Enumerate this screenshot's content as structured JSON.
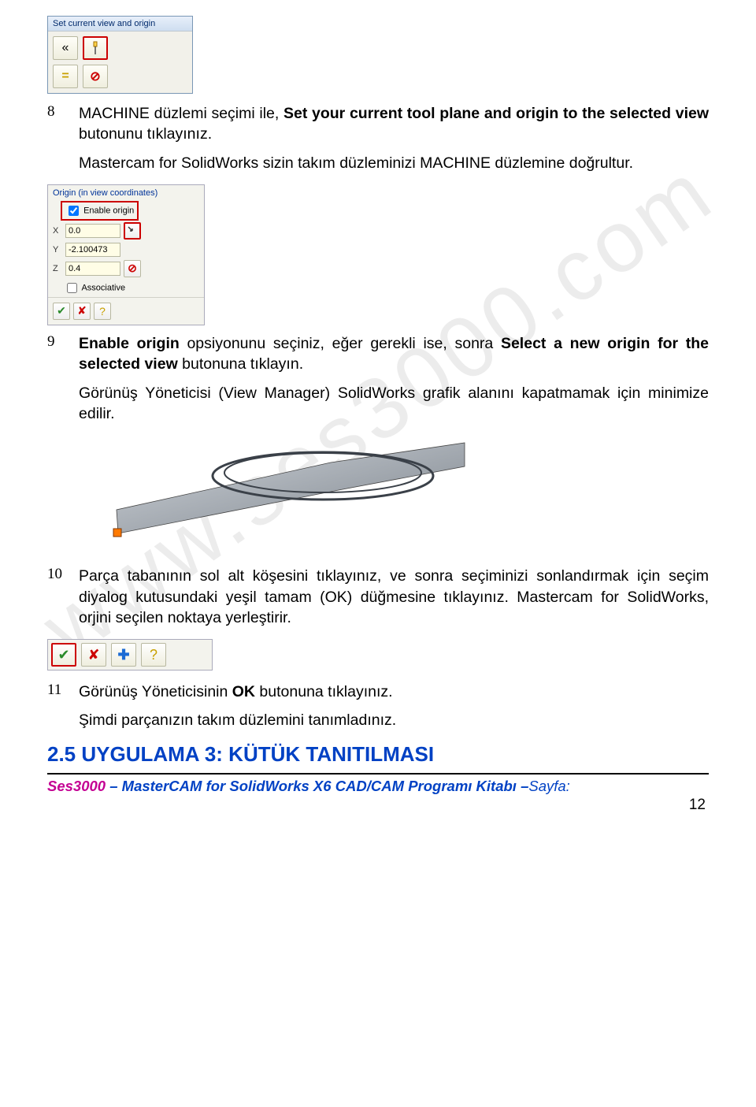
{
  "watermark": "www.ses3000.com",
  "dialog1": {
    "title": "Set current view and origin",
    "icons": [
      "arrow-left-icon",
      "origin-pin-icon",
      "equals-icon",
      "no-entry-icon"
    ]
  },
  "step8": {
    "num": "8",
    "text_pre": "MACHINE düzlemi seçimi ile, ",
    "bold": "Set your current tool plane and origin to the selected view",
    "text_post": " butonunu tıklayınız.",
    "para2": "Mastercam for SolidWorks sizin takım düzleminizi MACHINE düzlemine doğrultur."
  },
  "originDialog": {
    "section": "Origin (in view coordinates)",
    "enable_label": "Enable origin",
    "x_label": "X",
    "x_val": "0.0",
    "y_label": "Y",
    "y_val": "-2.100473",
    "z_label": "Z",
    "z_val": "0.4",
    "assoc_label": "Associative"
  },
  "step9": {
    "num": "9",
    "text_pre": "Enable origin",
    "text_mid": " opsiyonunu seçiniz, eğer gerekli ise, sonra ",
    "bold2": "Select a new origin for the selected view",
    "text_post": " butonuna tıklayın.",
    "para2": "Görünüş Yöneticisi (View Manager) SolidWorks grafik alanını kapatmamak için minimize edilir."
  },
  "step10": {
    "num": "10",
    "para": "Parça tabanının sol alt köşesini tıklayınız, ve sonra seçiminizi sonlandırmak için seçim diyalog kutusundaki yeşil tamam (OK) düğmesine tıklayınız. Mastercam for SolidWorks, orjini seçilen noktaya yerleştirir."
  },
  "step11": {
    "num": "11",
    "line1_pre": "Görünüş Yöneticisinin ",
    "line1_bold": "OK",
    "line1_post": " butonuna tıklayınız.",
    "line2": "Şimdi parçanızın takım düzlemini tanımladınız."
  },
  "heading": "2.5 UYGULAMA 3: KÜTÜK TANITILMASI",
  "footer": {
    "brand": "Ses3000",
    "dash": " – ",
    "title": "MasterCAM for SolidWorks X6 CAD/CAM Programı Kitabı",
    "dash2": " –",
    "sayfa": "Sayfa:",
    "num": "12"
  }
}
